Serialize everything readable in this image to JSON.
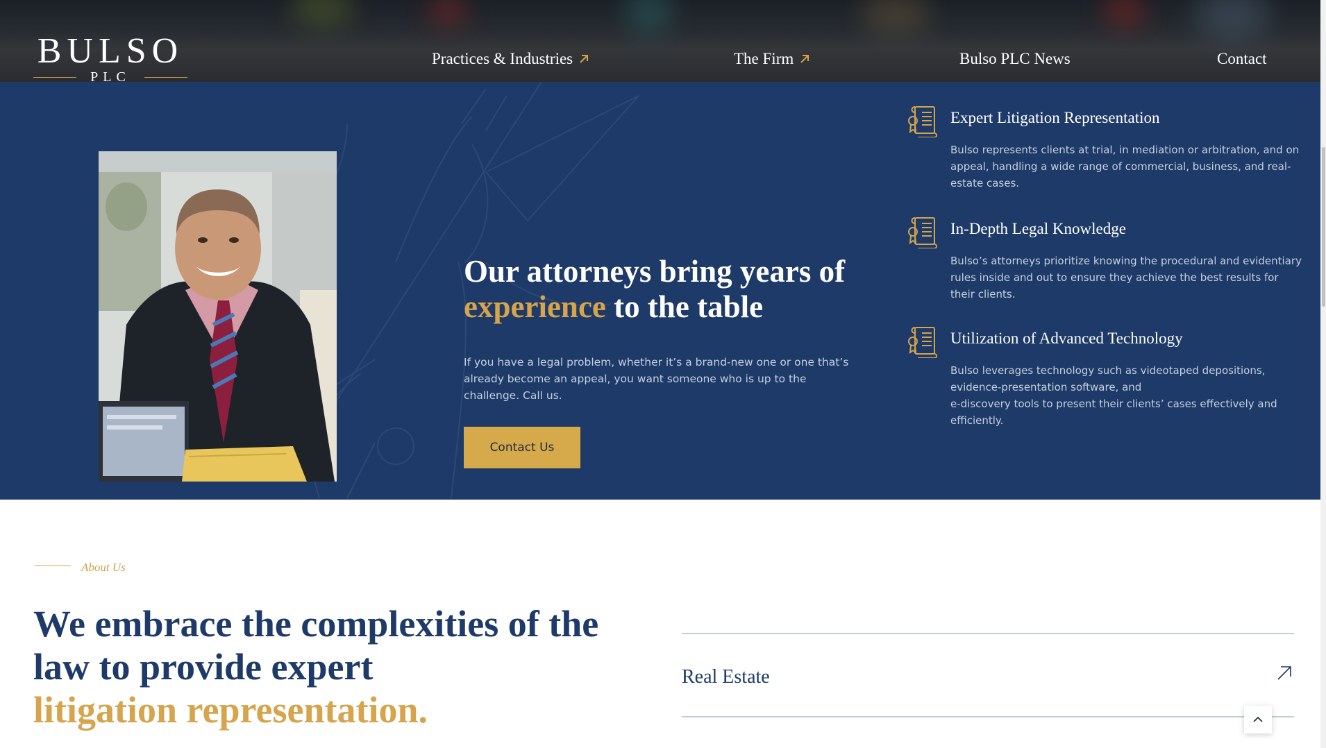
{
  "brand": {
    "name": "BULSO",
    "sub": "PLC",
    "gold": "#d5a44b",
    "navy": "#1d3a68"
  },
  "nav": {
    "items": [
      {
        "label": "Practices & Industries",
        "icon": "arrow-up-right-icon"
      },
      {
        "label": "The Firm",
        "icon": "arrow-up-right-icon"
      },
      {
        "label": "Bulso PLC News"
      },
      {
        "label": "Contact"
      }
    ]
  },
  "hero": {
    "headline_part1": "Our attorneys bring years of",
    "headline_highlight": "experience",
    "headline_part2": "to the table",
    "intro": "If you have a legal problem, whether it’s a brand-new one or one that’s already become an appeal, you want someone who is up to the challenge. Call us.",
    "cta_label": "Contact Us",
    "photo_icon": "attorney-portrait"
  },
  "features": [
    {
      "title": "Expert Litigation Representation",
      "text": "Bulso represents clients at trial, in mediation or arbitration, and on appeal, handling a wide range of commercial, business, and real-estate cases.",
      "icon": "certificate-scroll-icon"
    },
    {
      "title": "In-Depth Legal Knowledge",
      "text": "Bulso’s attorneys prioritize knowing the procedural and evidentiary rules inside and out to ensure they achieve the best results for their clients.",
      "icon": "certificate-scroll-icon"
    },
    {
      "title": "Utilization of Advanced Technology",
      "text_lines": [
        "Bulso leverages technology such as videotaped depositions,",
        "evidence-presentation software, and",
        "e-discovery tools to present their clients’ cases effectively and efficiently."
      ],
      "icon": "certificate-scroll-icon"
    }
  ],
  "about": {
    "eyebrow": "About Us",
    "title_line1": "We embrace the complexities of the",
    "title_line2": "law to provide expert",
    "title_highlight": "litigation representation.",
    "practice_areas": [
      {
        "label": "Real Estate",
        "icon": "arrow-up-right-icon"
      }
    ]
  },
  "scroll_to_top": {
    "icon": "chevron-up-icon"
  }
}
